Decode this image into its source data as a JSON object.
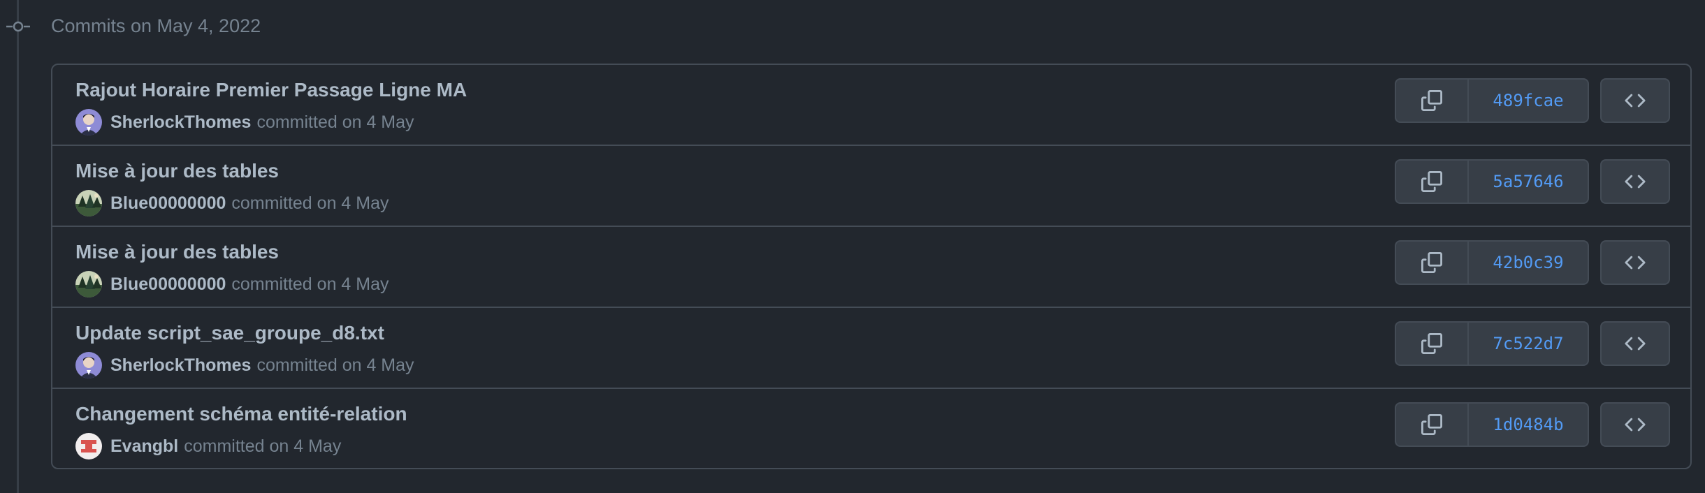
{
  "group_heading": "Commits on May 4, 2022",
  "icons": {
    "timeline": "git-commit-icon",
    "copy": "copy-icon",
    "browse": "code-icon"
  },
  "colors": {
    "background": "#22272e",
    "border": "#444c56",
    "sha_link": "#539bf5",
    "title_text": "#adbac7",
    "muted_text": "#768390"
  },
  "commits": [
    {
      "title": "Rajout Horaire Premier Passage Ligne MA",
      "author": "SherlockThomes",
      "committed_text": "committed on 4 May",
      "sha": "489fcae"
    },
    {
      "title": "Mise à jour des tables",
      "author": "Blue00000000",
      "committed_text": "committed on 4 May",
      "sha": "5a57646"
    },
    {
      "title": "Mise à jour des tables",
      "author": "Blue00000000",
      "committed_text": "committed on 4 May",
      "sha": "42b0c39"
    },
    {
      "title": "Update script_sae_groupe_d8.txt",
      "author": "SherlockThomes",
      "committed_text": "committed on 4 May",
      "sha": "7c522d7"
    },
    {
      "title": "Changement schéma entité-relation",
      "author": "Evangbl",
      "committed_text": "committed on 4 May",
      "sha": "1d0484b"
    }
  ]
}
